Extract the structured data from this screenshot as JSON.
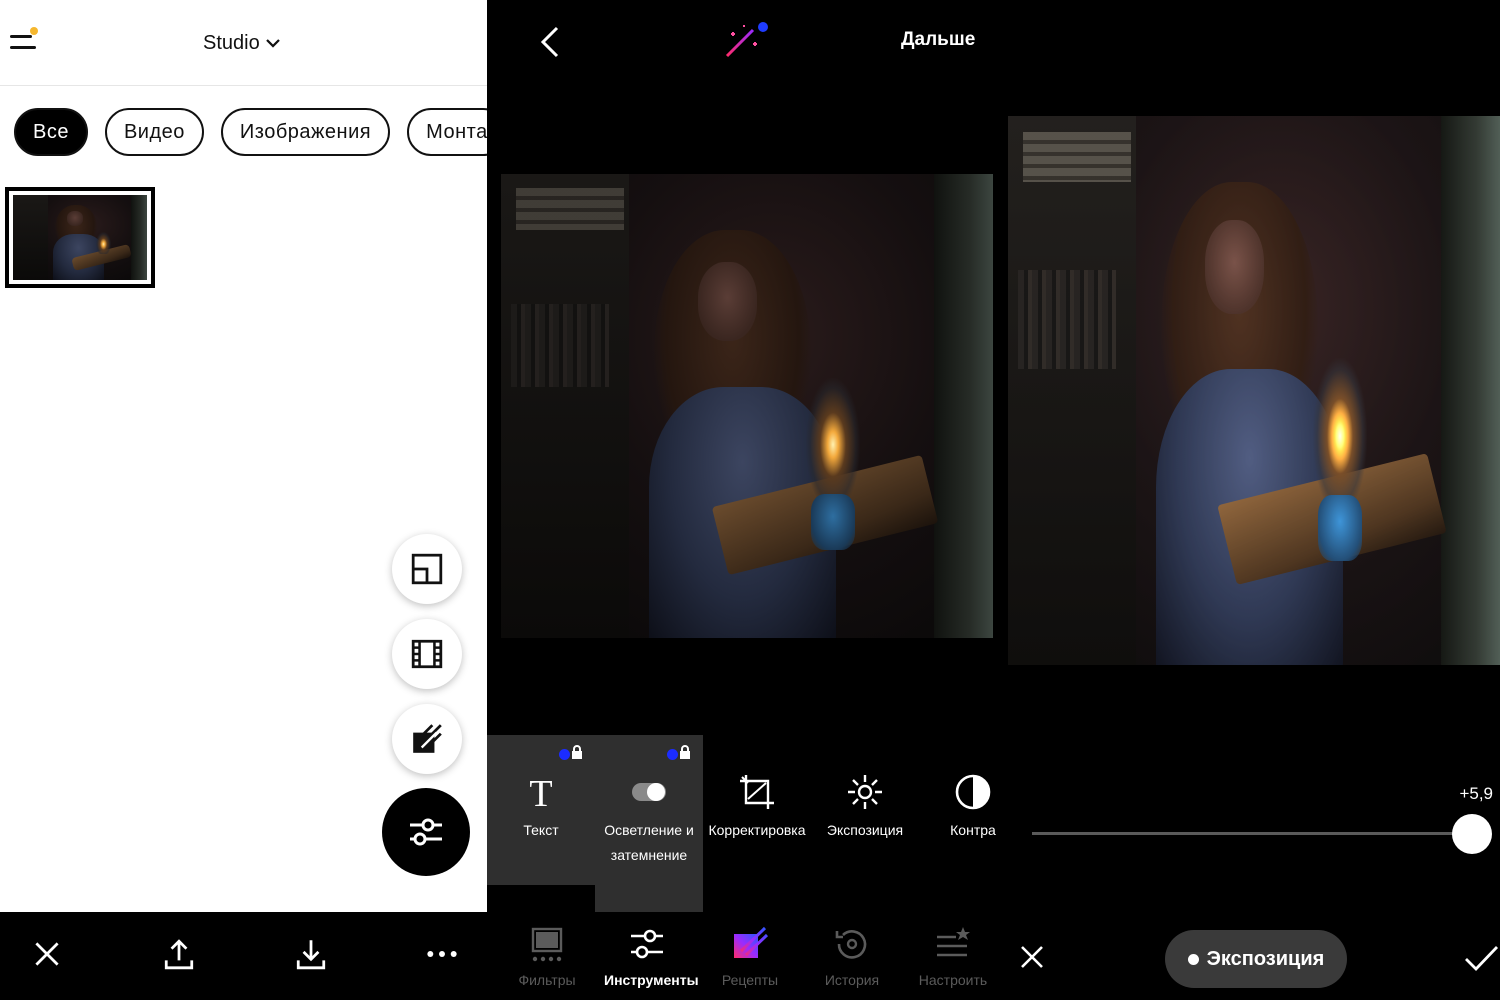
{
  "colors": {
    "menu_dot": "#f5b72e",
    "magic_dot": "#1f3cff",
    "lock_dot": "#1b2cff",
    "recipes_gradient": [
      "#ff2b6a",
      "#9a2bff",
      "#2b57ff"
    ]
  },
  "studio": {
    "title": "Studio",
    "chips": [
      {
        "label": "Все",
        "active": true
      },
      {
        "label": "Видео",
        "active": false
      },
      {
        "label": "Изображения",
        "active": false
      },
      {
        "label": "Монта",
        "active": false
      }
    ],
    "fab_icons": [
      "collage-icon",
      "film-icon",
      "draw-icon"
    ],
    "fab_main_icon": "sliders-icon",
    "bottom_icons": [
      "close-icon",
      "share-icon",
      "download-icon",
      "more-icon"
    ]
  },
  "editor": {
    "next_label": "Дальше",
    "tools": [
      {
        "label": "Текст",
        "icon": "text-icon",
        "locked": true
      },
      {
        "label": "Осветление и затемнение",
        "icon": "dodge-burn-icon",
        "locked": true
      },
      {
        "label": "Корректировка",
        "icon": "crop-adjust-icon",
        "locked": false
      },
      {
        "label": "Экспозиция",
        "icon": "sun-icon",
        "locked": false
      },
      {
        "label": "Контра",
        "icon": "contrast-icon",
        "locked": false
      }
    ],
    "nav": [
      {
        "label": "Фильтры",
        "icon": "filters-icon",
        "active": false
      },
      {
        "label": "Инструменты",
        "icon": "tools-icon",
        "active": true
      },
      {
        "label": "Рецепты",
        "icon": "recipes-icon",
        "active": false
      },
      {
        "label": "История",
        "icon": "history-icon",
        "active": false
      },
      {
        "label": "Настроить",
        "icon": "customize-icon",
        "active": false
      }
    ]
  },
  "exposure": {
    "value_label": "+5,9",
    "slider_fraction": 1.0,
    "pill_label": "Экспозиция"
  }
}
